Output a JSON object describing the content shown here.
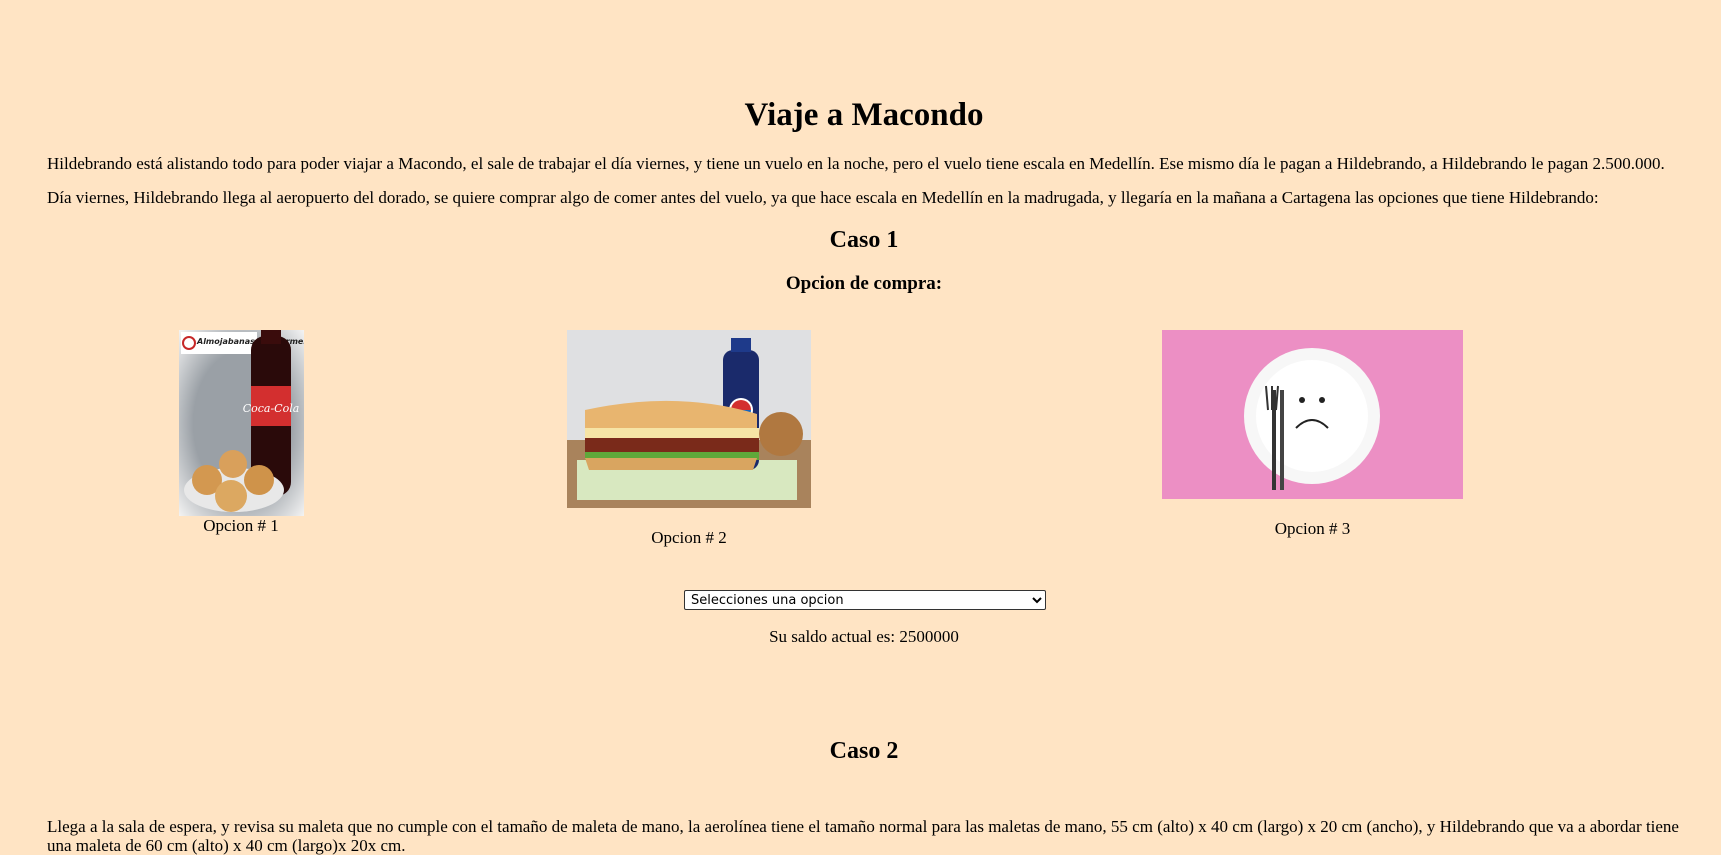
{
  "title": "Viaje a Macondo",
  "intro": [
    "Hildebrando está alistando todo para poder viajar a Macondo, el sale de trabajar el día viernes, y tiene un vuelo en la noche, pero el vuelo tiene escala en Medellín. Ese mismo día le pagan a Hildebrando, a Hildebrando le pagan 2.500.000.",
    "Día viernes, Hildebrando llega al aeropuerto del dorado, se quiere comprar algo de comer antes del vuelo, ya que hace escala en Medellín en la madrugada, y llegaría en la mañana a Cartagena las opciones que tiene Hildebrando:"
  ],
  "caso1": {
    "heading": "Caso 1",
    "subheading": "Opcion de compra:",
    "options": [
      {
        "caption": "Opcion # 1",
        "logo_text": "Almojabanas del Carmen",
        "bottle_text": "Coca-Cola"
      },
      {
        "caption": "Opcion # 2"
      },
      {
        "caption": "Opcion # 3"
      }
    ],
    "select_value": "Selecciones una opcion",
    "saldo": "Su saldo actual es: 2500000"
  },
  "caso2": {
    "heading": "Caso 2",
    "text": "Llega a la sala de espera, y revisa su maleta que no cumple con el tamaño de maleta de mano, la aerolínea tiene el tamaño normal para las maletas de mano, 55 cm (alto) x 40 cm (largo) x 20 cm (ancho), y Hildebrando que va a abordar tiene una maleta de 60 cm (alto) x 40 cm (largo)x 20x cm."
  }
}
